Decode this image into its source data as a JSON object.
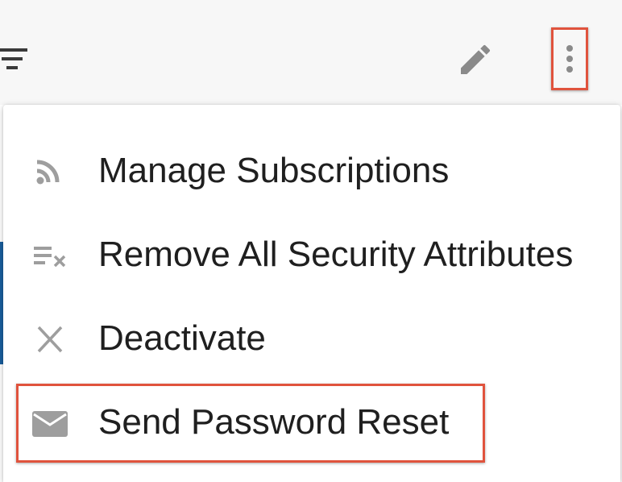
{
  "toolbar": {
    "filter_icon": "filter-list-icon",
    "edit_icon": "pencil-icon",
    "more_icon": "more-vert-icon"
  },
  "menu": {
    "items": [
      {
        "label": "Manage Subscriptions",
        "icon": "rss-feed-icon"
      },
      {
        "label": "Remove All Security Attributes",
        "icon": "clear-all-icon"
      },
      {
        "label": "Deactivate",
        "icon": "close-icon"
      },
      {
        "label": "Send Password Reset",
        "icon": "mail-icon"
      }
    ]
  },
  "colors": {
    "highlight": "#e0533d",
    "icon_gray": "#9e9e9e",
    "text": "#1f1f1f"
  }
}
